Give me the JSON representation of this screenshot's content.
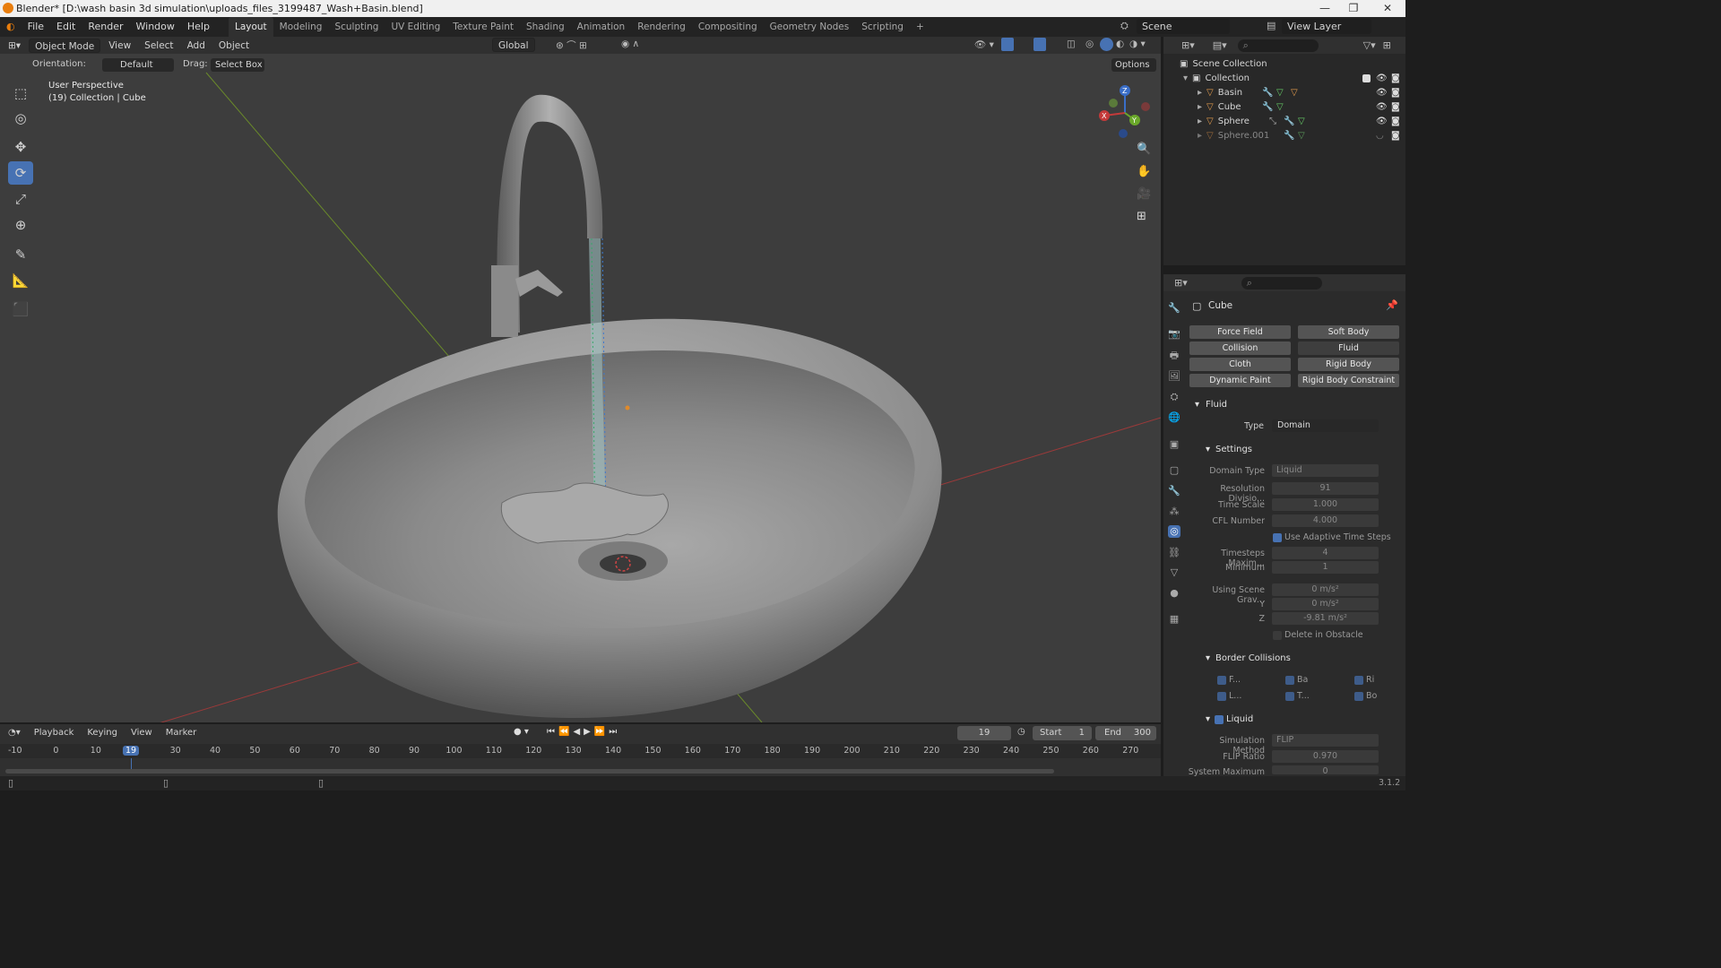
{
  "window": {
    "title": "Blender* [D:\\wash basin 3d simulation\\uploads_files_3199487_Wash+Basin.blend]"
  },
  "menubar": {
    "menus": [
      "File",
      "Edit",
      "Render",
      "Window",
      "Help"
    ],
    "workspaces": [
      "Layout",
      "Modeling",
      "Sculpting",
      "UV Editing",
      "Texture Paint",
      "Shading",
      "Animation",
      "Rendering",
      "Compositing",
      "Geometry Nodes",
      "Scripting"
    ],
    "add_workspace": "+",
    "scene": "Scene",
    "view_layer": "View Layer"
  },
  "viewport": {
    "mode": "Object Mode",
    "menus": [
      "View",
      "Select",
      "Add",
      "Object"
    ],
    "transform": "Global",
    "orientation_label": "Orientation:",
    "orientation_value": "Default",
    "drag_label": "Drag:",
    "drag_value": "Select Box",
    "options": "Options",
    "perspective": "User Perspective",
    "collection_info": "(19) Collection | Cube",
    "gizmo": {
      "x": "X",
      "y": "Y",
      "z": "Z"
    }
  },
  "outliner": {
    "root": "Scene Collection",
    "collection": "Collection",
    "objects": [
      {
        "name": "Basin",
        "dim": false
      },
      {
        "name": "Cube",
        "dim": false
      },
      {
        "name": "Sphere",
        "dim": false
      },
      {
        "name": "Sphere.001",
        "dim": true
      }
    ]
  },
  "properties": {
    "object": "Cube",
    "physics_buttons": [
      [
        "Force Field",
        "Soft Body"
      ],
      [
        "Collision",
        "Fluid"
      ],
      [
        "Cloth",
        "Rigid Body"
      ],
      [
        "Dynamic Paint",
        "Rigid Body Constraint"
      ]
    ],
    "fluid": {
      "section": "Fluid",
      "type_label": "Type",
      "type_value": "Domain",
      "settings": "Settings",
      "fields": [
        {
          "label": "Domain Type",
          "value": "Liquid"
        },
        {
          "label": "Resolution Divisio...",
          "value": "91"
        },
        {
          "label": "Time Scale",
          "value": "1.000"
        },
        {
          "label": "CFL Number",
          "value": "4.000"
        }
      ],
      "adaptive": "Use Adaptive Time Steps",
      "fields2": [
        {
          "label": "Timesteps Maxim...",
          "value": "4"
        },
        {
          "label": "Minimum",
          "value": "1"
        },
        {
          "label": "Using Scene Grav...",
          "value": "0 m/s²"
        },
        {
          "label": "Y",
          "value": "0 m/s²"
        },
        {
          "label": "Z",
          "value": "-9.81 m/s²"
        }
      ],
      "delete_obstacle": "Delete in Obstacle",
      "border_collisions": "Border Collisions",
      "borders": [
        "F...",
        "Ba",
        "Ri",
        "L...",
        "T...",
        "Bo"
      ],
      "liquid": "Liquid",
      "fields3": [
        {
          "label": "Simulation Method",
          "value": "FLIP"
        },
        {
          "label": "FLIP Ratio",
          "value": "0.970"
        },
        {
          "label": "System Maximum",
          "value": "0"
        }
      ]
    }
  },
  "timeline": {
    "menus": [
      "Playback",
      "Keying",
      "View",
      "Marker"
    ],
    "current_frame": "19",
    "start_label": "Start",
    "start": "1",
    "end_label": "End",
    "end": "300",
    "ticks": [
      "-10",
      "0",
      "10",
      "19",
      "30",
      "40",
      "50",
      "60",
      "70",
      "80",
      "90",
      "100",
      "110",
      "120",
      "130",
      "140",
      "150",
      "160",
      "170",
      "180",
      "190",
      "200",
      "210",
      "220",
      "230",
      "240",
      "250",
      "260",
      "270"
    ]
  },
  "status": {
    "version": "3.1.2"
  }
}
